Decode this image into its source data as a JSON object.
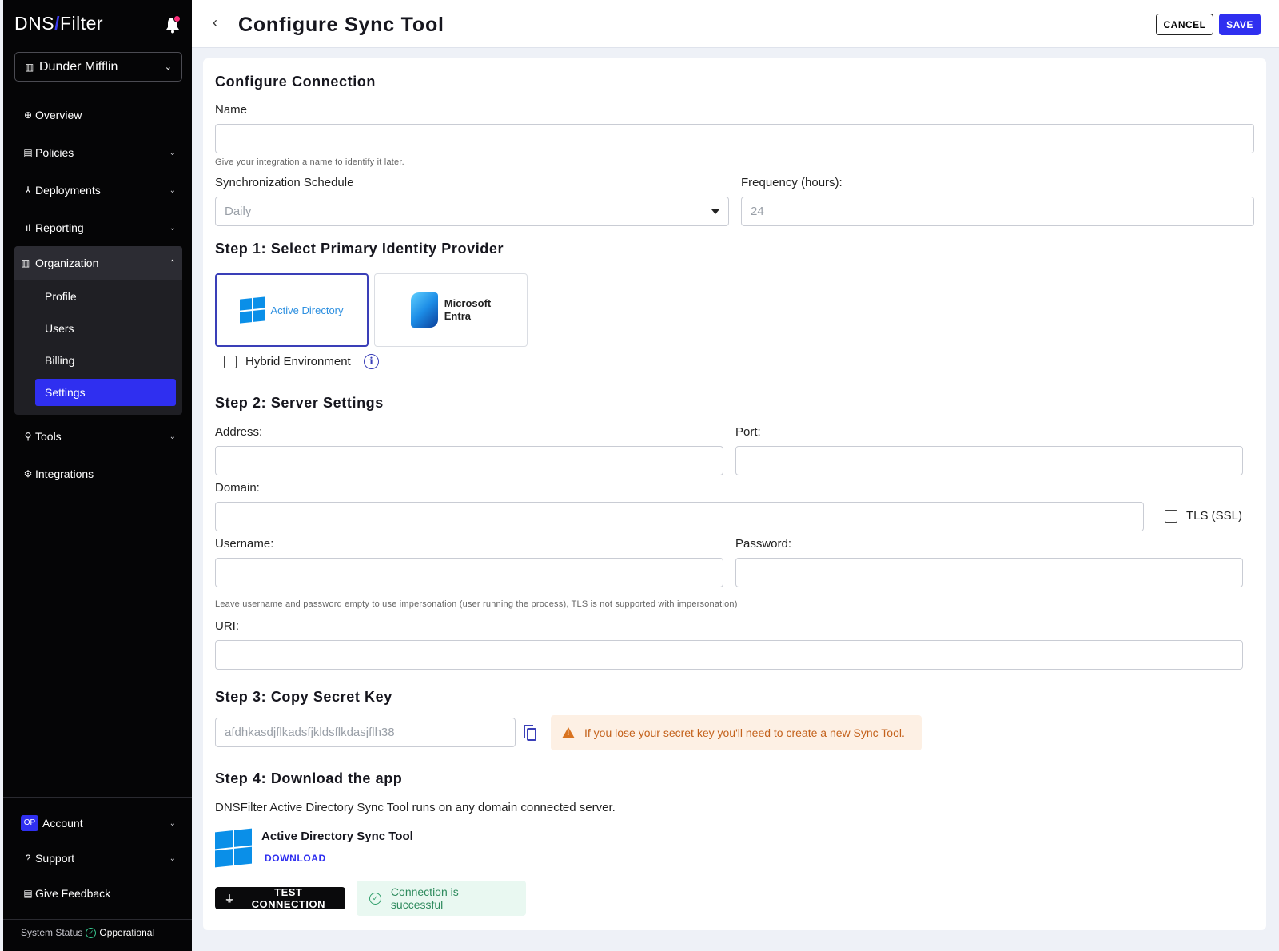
{
  "brand": {
    "part1": "DNS",
    "slash": "/",
    "part2": "Filter"
  },
  "sidebar": {
    "org_name": "Dunder Mifflin",
    "items": [
      {
        "label": "Overview"
      },
      {
        "label": "Policies"
      },
      {
        "label": "Deployments"
      },
      {
        "label": "Reporting"
      },
      {
        "label": "Organization"
      },
      {
        "label": "Tools"
      },
      {
        "label": "Integrations"
      }
    ],
    "org_sub": [
      {
        "label": "Profile"
      },
      {
        "label": "Users"
      },
      {
        "label": "Billing"
      },
      {
        "label": "Settings"
      }
    ],
    "bottom": {
      "account_badge": "OP",
      "account": "Account",
      "support": "Support",
      "feedback": "Give Feedback"
    },
    "status_label": "System Status",
    "status_value": "Opperational"
  },
  "header": {
    "title": "Configure Sync Tool",
    "cancel": "CANCEL",
    "save": "SAVE"
  },
  "connection": {
    "heading": "Configure Connection",
    "name_label": "Name",
    "name_value": "",
    "name_hint": "Give your integration a name to identify it later.",
    "schedule_label": "Synchronization Schedule",
    "schedule_value": "Daily",
    "frequency_label": "Frequency (hours):",
    "frequency_value": "24"
  },
  "step1": {
    "heading": "Step 1: Select Primary Identity Provider",
    "provider_ad": "Active Directory",
    "provider_entra_line1": "Microsoft",
    "provider_entra_line2": "Entra",
    "hybrid_label": "Hybrid Environment",
    "hybrid_checked": false
  },
  "step2": {
    "heading": "Step 2: Server Settings",
    "address_label": "Address:",
    "port_label": "Port:",
    "domain_label": "Domain:",
    "tls_label": "TLS (SSL)",
    "tls_checked": false,
    "username_label": "Username:",
    "password_label": "Password:",
    "credentials_hint": "Leave username and password empty to use impersonation (user running the process), TLS is not supported with impersonation)",
    "uri_label": "URI:"
  },
  "step3": {
    "heading": "Step 3: Copy Secret Key",
    "secret_key": "afdhkasdjflkadsfjkldsflkdasjflh38",
    "warning": "If you lose your secret key you'll need to create a new Sync Tool."
  },
  "step4": {
    "heading": "Step 4: Download the app",
    "description": "DNSFilter Active Directory Sync Tool runs on any domain connected server.",
    "app_name": "Active Directory Sync Tool",
    "download": "DOWNLOAD"
  },
  "actions": {
    "test": "TEST CONNECTION",
    "success": "Connection is successful"
  },
  "colors": {
    "accent": "#2f2ff0",
    "sidebar_bg": "#050506",
    "success": "#2f8b5e",
    "warning": "#c4621c"
  }
}
